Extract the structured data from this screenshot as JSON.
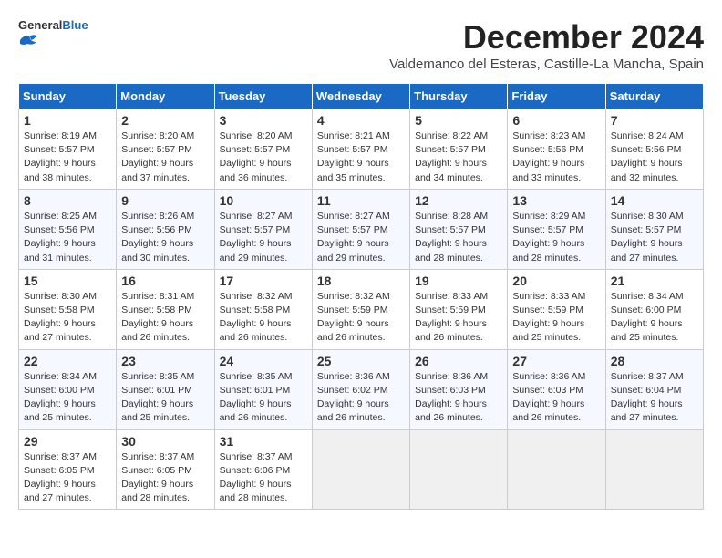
{
  "header": {
    "logo_general": "General",
    "logo_blue": "Blue",
    "month": "December 2024",
    "location": "Valdemanco del Esteras, Castille-La Mancha, Spain"
  },
  "weekdays": [
    "Sunday",
    "Monday",
    "Tuesday",
    "Wednesday",
    "Thursday",
    "Friday",
    "Saturday"
  ],
  "weeks": [
    [
      {
        "day": "1",
        "sunrise": "8:19 AM",
        "sunset": "5:57 PM",
        "daylight": "9 hours and 38 minutes."
      },
      {
        "day": "2",
        "sunrise": "8:20 AM",
        "sunset": "5:57 PM",
        "daylight": "9 hours and 37 minutes."
      },
      {
        "day": "3",
        "sunrise": "8:20 AM",
        "sunset": "5:57 PM",
        "daylight": "9 hours and 36 minutes."
      },
      {
        "day": "4",
        "sunrise": "8:21 AM",
        "sunset": "5:57 PM",
        "daylight": "9 hours and 35 minutes."
      },
      {
        "day": "5",
        "sunrise": "8:22 AM",
        "sunset": "5:57 PM",
        "daylight": "9 hours and 34 minutes."
      },
      {
        "day": "6",
        "sunrise": "8:23 AM",
        "sunset": "5:56 PM",
        "daylight": "9 hours and 33 minutes."
      },
      {
        "day": "7",
        "sunrise": "8:24 AM",
        "sunset": "5:56 PM",
        "daylight": "9 hours and 32 minutes."
      }
    ],
    [
      {
        "day": "8",
        "sunrise": "8:25 AM",
        "sunset": "5:56 PM",
        "daylight": "9 hours and 31 minutes."
      },
      {
        "day": "9",
        "sunrise": "8:26 AM",
        "sunset": "5:56 PM",
        "daylight": "9 hours and 30 minutes."
      },
      {
        "day": "10",
        "sunrise": "8:27 AM",
        "sunset": "5:57 PM",
        "daylight": "9 hours and 29 minutes."
      },
      {
        "day": "11",
        "sunrise": "8:27 AM",
        "sunset": "5:57 PM",
        "daylight": "9 hours and 29 minutes."
      },
      {
        "day": "12",
        "sunrise": "8:28 AM",
        "sunset": "5:57 PM",
        "daylight": "9 hours and 28 minutes."
      },
      {
        "day": "13",
        "sunrise": "8:29 AM",
        "sunset": "5:57 PM",
        "daylight": "9 hours and 28 minutes."
      },
      {
        "day": "14",
        "sunrise": "8:30 AM",
        "sunset": "5:57 PM",
        "daylight": "9 hours and 27 minutes."
      }
    ],
    [
      {
        "day": "15",
        "sunrise": "8:30 AM",
        "sunset": "5:58 PM",
        "daylight": "9 hours and 27 minutes."
      },
      {
        "day": "16",
        "sunrise": "8:31 AM",
        "sunset": "5:58 PM",
        "daylight": "9 hours and 26 minutes."
      },
      {
        "day": "17",
        "sunrise": "8:32 AM",
        "sunset": "5:58 PM",
        "daylight": "9 hours and 26 minutes."
      },
      {
        "day": "18",
        "sunrise": "8:32 AM",
        "sunset": "5:59 PM",
        "daylight": "9 hours and 26 minutes."
      },
      {
        "day": "19",
        "sunrise": "8:33 AM",
        "sunset": "5:59 PM",
        "daylight": "9 hours and 26 minutes."
      },
      {
        "day": "20",
        "sunrise": "8:33 AM",
        "sunset": "5:59 PM",
        "daylight": "9 hours and 25 minutes."
      },
      {
        "day": "21",
        "sunrise": "8:34 AM",
        "sunset": "6:00 PM",
        "daylight": "9 hours and 25 minutes."
      }
    ],
    [
      {
        "day": "22",
        "sunrise": "8:34 AM",
        "sunset": "6:00 PM",
        "daylight": "9 hours and 25 minutes."
      },
      {
        "day": "23",
        "sunrise": "8:35 AM",
        "sunset": "6:01 PM",
        "daylight": "9 hours and 25 minutes."
      },
      {
        "day": "24",
        "sunrise": "8:35 AM",
        "sunset": "6:01 PM",
        "daylight": "9 hours and 26 minutes."
      },
      {
        "day": "25",
        "sunrise": "8:36 AM",
        "sunset": "6:02 PM",
        "daylight": "9 hours and 26 minutes."
      },
      {
        "day": "26",
        "sunrise": "8:36 AM",
        "sunset": "6:03 PM",
        "daylight": "9 hours and 26 minutes."
      },
      {
        "day": "27",
        "sunrise": "8:36 AM",
        "sunset": "6:03 PM",
        "daylight": "9 hours and 26 minutes."
      },
      {
        "day": "28",
        "sunrise": "8:37 AM",
        "sunset": "6:04 PM",
        "daylight": "9 hours and 27 minutes."
      }
    ],
    [
      {
        "day": "29",
        "sunrise": "8:37 AM",
        "sunset": "6:05 PM",
        "daylight": "9 hours and 27 minutes."
      },
      {
        "day": "30",
        "sunrise": "8:37 AM",
        "sunset": "6:05 PM",
        "daylight": "9 hours and 28 minutes."
      },
      {
        "day": "31",
        "sunrise": "8:37 AM",
        "sunset": "6:06 PM",
        "daylight": "9 hours and 28 minutes."
      },
      null,
      null,
      null,
      null
    ]
  ],
  "labels": {
    "sunrise": "Sunrise:",
    "sunset": "Sunset:",
    "daylight": "Daylight:"
  }
}
